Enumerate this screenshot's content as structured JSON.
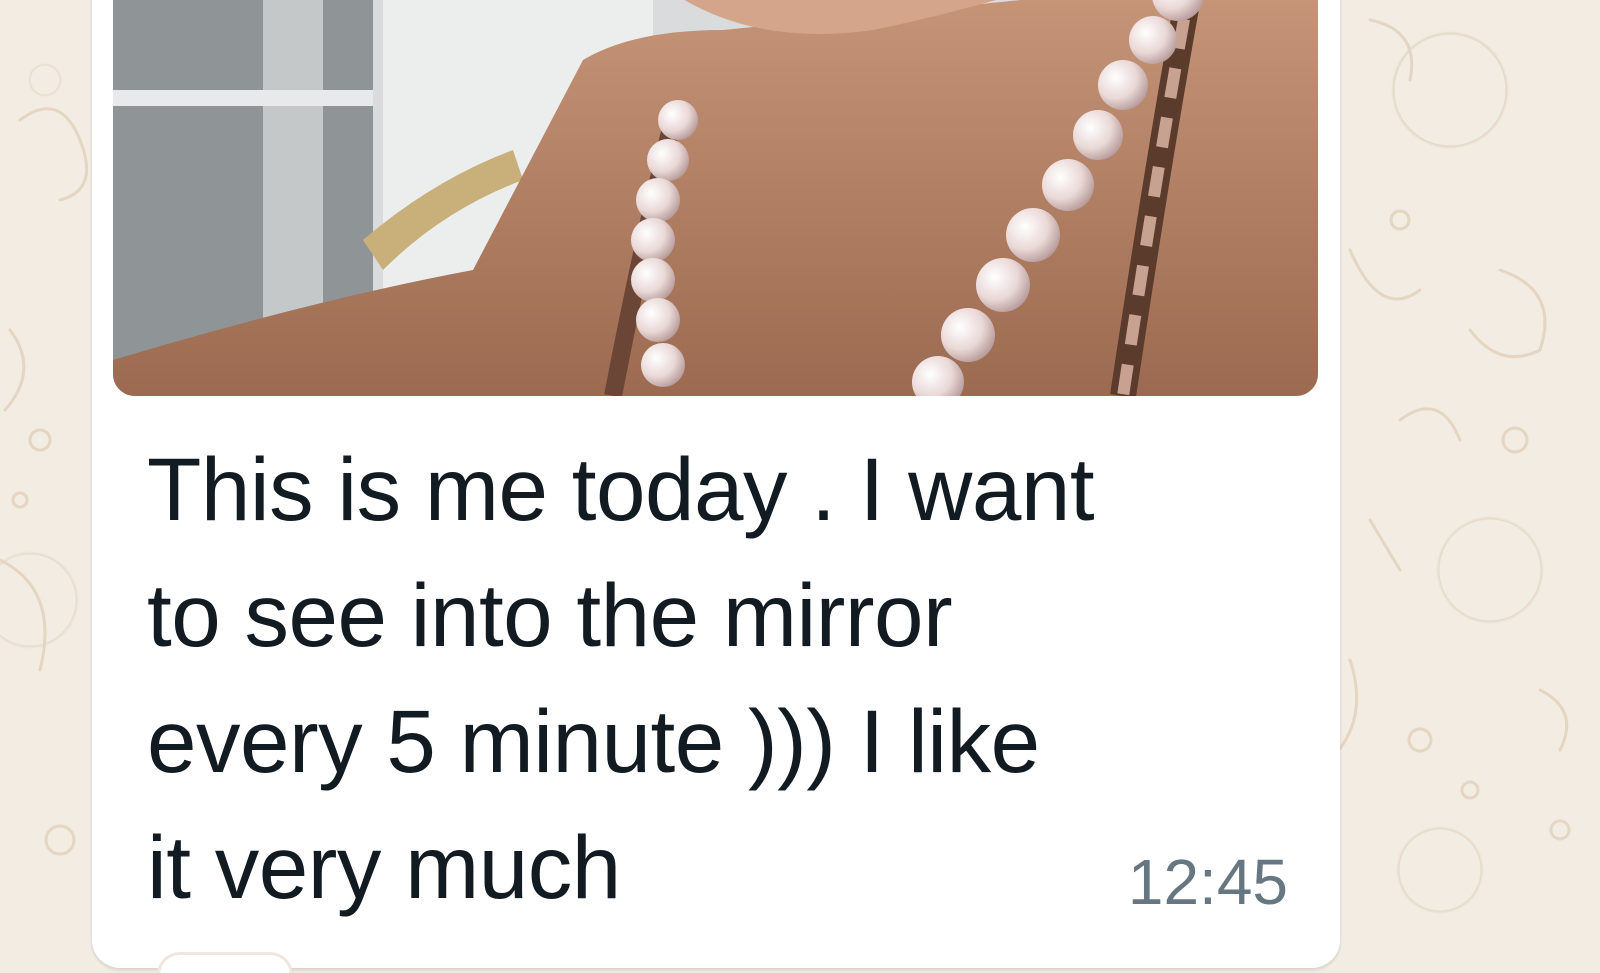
{
  "message": {
    "caption_lines": [
      "This is me today . I want",
      "to see into the mirror",
      "every 5 minute ))) I like",
      "it very much"
    ],
    "timestamp": "12:45"
  },
  "photo": {
    "subject": "person-wearing-pearl-necklace"
  },
  "colors": {
    "bubble": "#ffffff",
    "wallpaper": "#f2ece3",
    "text": "#111b21",
    "timestamp": "#667781"
  },
  "icons": [
    "doodle-wallpaper-icon"
  ]
}
